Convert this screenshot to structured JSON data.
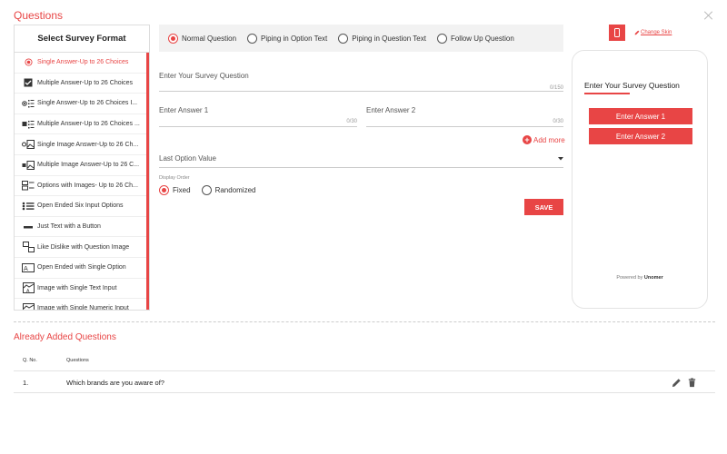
{
  "header": {
    "title": "Questions"
  },
  "formats": {
    "heading": "Select Survey Format",
    "items": [
      {
        "label": "Single Answer-Up to 26 Choices",
        "icon": "radio-icon",
        "active": true
      },
      {
        "label": "Multiple Answer-Up to 26 Choices",
        "icon": "checkbox-icon"
      },
      {
        "label": "Single Answer-Up to 26 Choices I...",
        "icon": "radio-list-icon"
      },
      {
        "label": "Multiple Answer-Up to 26 Choices ...",
        "icon": "checkbox-list-icon"
      },
      {
        "label": "Single Image Answer-Up to 26 Ch...",
        "icon": "image-list-icon"
      },
      {
        "label": "Multiple Image Answer-Up to 26 C...",
        "icon": "image-checkbox-icon"
      },
      {
        "label": "Options with Images- Up to 26 Ch...",
        "icon": "image-options-icon"
      },
      {
        "label": "Open Ended Six Input Options",
        "icon": "six-inputs-icon"
      },
      {
        "label": "Just Text with a Button",
        "icon": "button-icon"
      },
      {
        "label": "Like Dislike with Question Image",
        "icon": "like-dislike-icon"
      },
      {
        "label": "Open Ended with Single Option",
        "icon": "text-input-icon"
      },
      {
        "label": "Image with Single Text Input",
        "icon": "image-text-icon"
      },
      {
        "label": "Image with Single Numeric Input",
        "icon": "image-numeric-icon"
      }
    ]
  },
  "question_types": [
    {
      "label": "Normal Question",
      "selected": true
    },
    {
      "label": "Piping in Option Text",
      "selected": false
    },
    {
      "label": "Piping in Question Text",
      "selected": false
    },
    {
      "label": "Follow Up Question",
      "selected": false
    }
  ],
  "editor": {
    "question_placeholder": "Enter Your Survey Question",
    "question_count": "0/150",
    "answer1_placeholder": "Enter Answer 1",
    "answer1_count": "0/30",
    "answer2_placeholder": "Enter Answer 2",
    "answer2_count": "0/30",
    "add_more": "Add more",
    "last_option_placeholder": "Last Option Value",
    "display_order_label": "Display Order",
    "display_order_options": [
      {
        "label": "Fixed",
        "selected": true
      },
      {
        "label": "Randomized",
        "selected": false
      }
    ],
    "save_label": "SAVE"
  },
  "preview": {
    "change_skin": "Change Skin",
    "question": "Enter Your Survey Question",
    "answers": [
      "Enter Answer 1",
      "Enter Answer 2"
    ],
    "powered_by": "Powered by",
    "brand": "Unomer"
  },
  "added": {
    "title": "Already Added Questions",
    "col_no": "Q. No.",
    "col_questions": "Questions",
    "rows": [
      {
        "no": "1.",
        "question": "Which brands are you aware of?"
      }
    ]
  },
  "colors": {
    "accent": "#e84545"
  }
}
